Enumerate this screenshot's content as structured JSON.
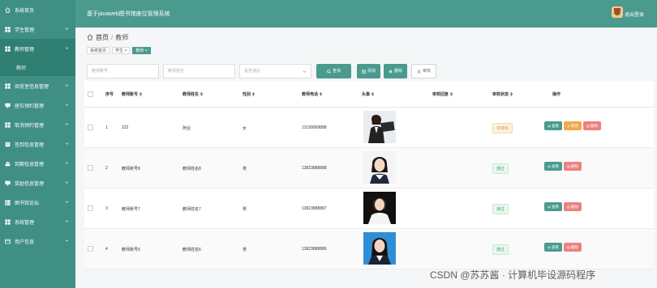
{
  "app": {
    "title": "基于javaweb图书馆座位管理系统",
    "logout_label": "退出登录"
  },
  "sidebar": {
    "items": [
      {
        "label": "系统首页",
        "icon": "home-icon",
        "has_arrow": false
      },
      {
        "label": "学生管理",
        "icon": "grid-icon",
        "has_arrow": true
      },
      {
        "label": "教师管理",
        "icon": "grid-icon",
        "has_arrow": true,
        "active": true
      },
      {
        "label": "阅览室信息管理",
        "icon": "grid-icon",
        "has_arrow": true
      },
      {
        "label": "座位预约管理",
        "icon": "desk-icon",
        "has_arrow": true
      },
      {
        "label": "取消预约管理",
        "icon": "grid-icon",
        "has_arrow": true
      },
      {
        "label": "签到信息管理",
        "icon": "book-icon",
        "has_arrow": true
      },
      {
        "label": "到期信息管理",
        "icon": "bank-icon",
        "has_arrow": true
      },
      {
        "label": "奖励信息管理",
        "icon": "desk-icon",
        "has_arrow": true
      },
      {
        "label": "图书馆论坛",
        "icon": "table-icon",
        "has_arrow": true
      },
      {
        "label": "系统管理",
        "icon": "grid-icon",
        "has_arrow": true
      },
      {
        "label": "用户信息",
        "icon": "card-icon",
        "has_arrow": true
      }
    ],
    "sub_item": "教师"
  },
  "breadcrumb": {
    "home": "首页",
    "sep": "/",
    "current": "教师"
  },
  "tabs": [
    {
      "label": "系统首页",
      "active": false
    },
    {
      "label": "学生 ×",
      "active": false
    },
    {
      "label": "教师 ×",
      "active": true
    }
  ],
  "filters": {
    "teacher_no_placeholder": "教师账号",
    "teacher_name_placeholder": "教师姓名",
    "review_placeholder": "是否通过",
    "search_label": "查询",
    "add_label": "添加",
    "delete_label": "删除",
    "review_label": "审核"
  },
  "table": {
    "headers": [
      "序号",
      "教师账号 ≑",
      "教师姓名 ≑",
      "性别 ≑",
      "教师电话 ≑",
      "头像 ≑",
      "审核回复 ≑",
      "审核状态 ≑",
      "操作"
    ],
    "rows": [
      {
        "idx": "1",
        "account": "222",
        "name": "阿业",
        "gender": "女",
        "phone": "13199999888",
        "status": "待审核",
        "status_type": "pending",
        "ops": [
          "查看",
          "修改",
          "删除"
        ]
      },
      {
        "idx": "2",
        "account": "教师账号8",
        "name": "教师姓名8",
        "gender": "男",
        "phone": "13823888888",
        "status": "通过",
        "status_type": "ok",
        "ops": [
          "查看",
          "删除"
        ]
      },
      {
        "idx": "3",
        "account": "教师账号7",
        "name": "教师姓名7",
        "gender": "男",
        "phone": "13823888887",
        "status": "通过",
        "status_type": "ok",
        "ops": [
          "查看",
          "删除"
        ]
      },
      {
        "idx": "4",
        "account": "教师账号6",
        "name": "教师姓名6",
        "gender": "男",
        "phone": "13823888886",
        "status": "通过",
        "status_type": "ok",
        "ops": [
          "查看",
          "删除"
        ]
      }
    ]
  },
  "watermark": "CSDN @苏苏酱 · 计算机毕设源码程序",
  "colors": {
    "sidebar": "#3f8f84",
    "topbar": "#4a9a8e",
    "accent": "#4a9a8e",
    "edit": "#f0a94c",
    "delete": "#ee8080"
  }
}
